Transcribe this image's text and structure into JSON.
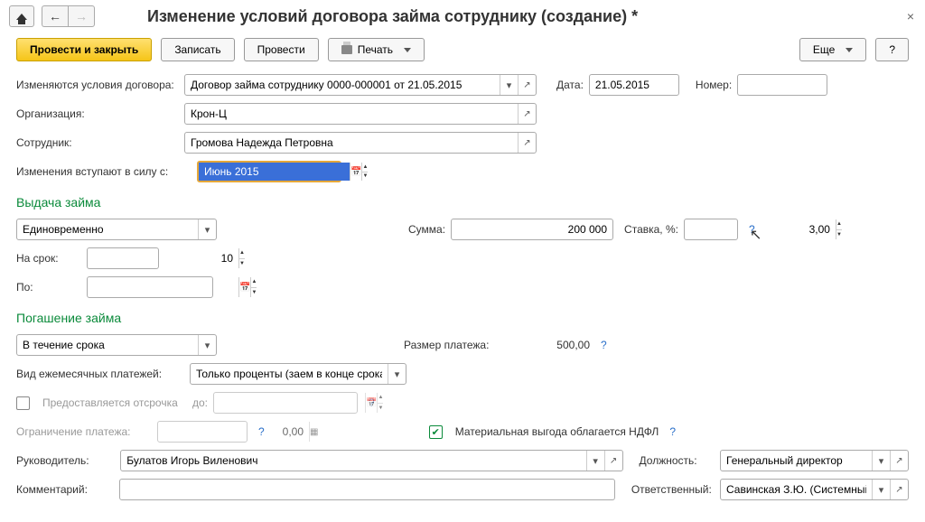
{
  "header": {
    "title": "Изменение условий договора займа сотруднику (создание) *"
  },
  "toolbar": {
    "post_close": "Провести и закрыть",
    "write": "Записать",
    "post": "Провести",
    "print": "Печать",
    "more": "Еще",
    "help": "?"
  },
  "fields": {
    "conditions_label": "Изменяются условия договора:",
    "conditions_value": "Договор займа сотруднику 0000-000001 от 21.05.2015",
    "date_label": "Дата:",
    "date_value": "21.05.2015",
    "number_label": "Номер:",
    "number_value": "",
    "org_label": "Организация:",
    "org_value": "Крон-Ц",
    "employee_label": "Сотрудник:",
    "employee_value": "Громова Надежда Петровна",
    "effective_label": "Изменения вступают в силу с:",
    "effective_value": "Июнь 2015"
  },
  "issuance": {
    "title": "Выдача займа",
    "mode": "Единовременно",
    "amount_label": "Сумма:",
    "amount_value": "200 000",
    "rate_label": "Ставка, %:",
    "rate_value": "3,00",
    "term_label": "На срок:",
    "term_value": "10",
    "until_label": "По:",
    "until_value": ""
  },
  "repayment": {
    "title": "Погашение займа",
    "mode": "В течение срока",
    "payment_size_label": "Размер платежа:",
    "payment_size_value": "500,00",
    "monthly_type_label": "Вид ежемесячных платежей:",
    "monthly_type_value": "Только проценты (заем в конце срока)",
    "deferral_label": "Предоставляется отсрочка",
    "deferral_until_label": "до:",
    "deferral_until_value": "",
    "limit_label": "Ограничение платежа:",
    "limit_value": "0,00",
    "ndfl_label": "Материальная выгода облагается НДФЛ"
  },
  "footer": {
    "manager_label": "Руководитель:",
    "manager_value": "Булатов Игорь Виленович",
    "position_label": "Должность:",
    "position_value": "Генеральный директор",
    "comment_label": "Комментарий:",
    "comment_value": "",
    "responsible_label": "Ответственный:",
    "responsible_value": "Савинская З.Ю. (Системный прог"
  }
}
